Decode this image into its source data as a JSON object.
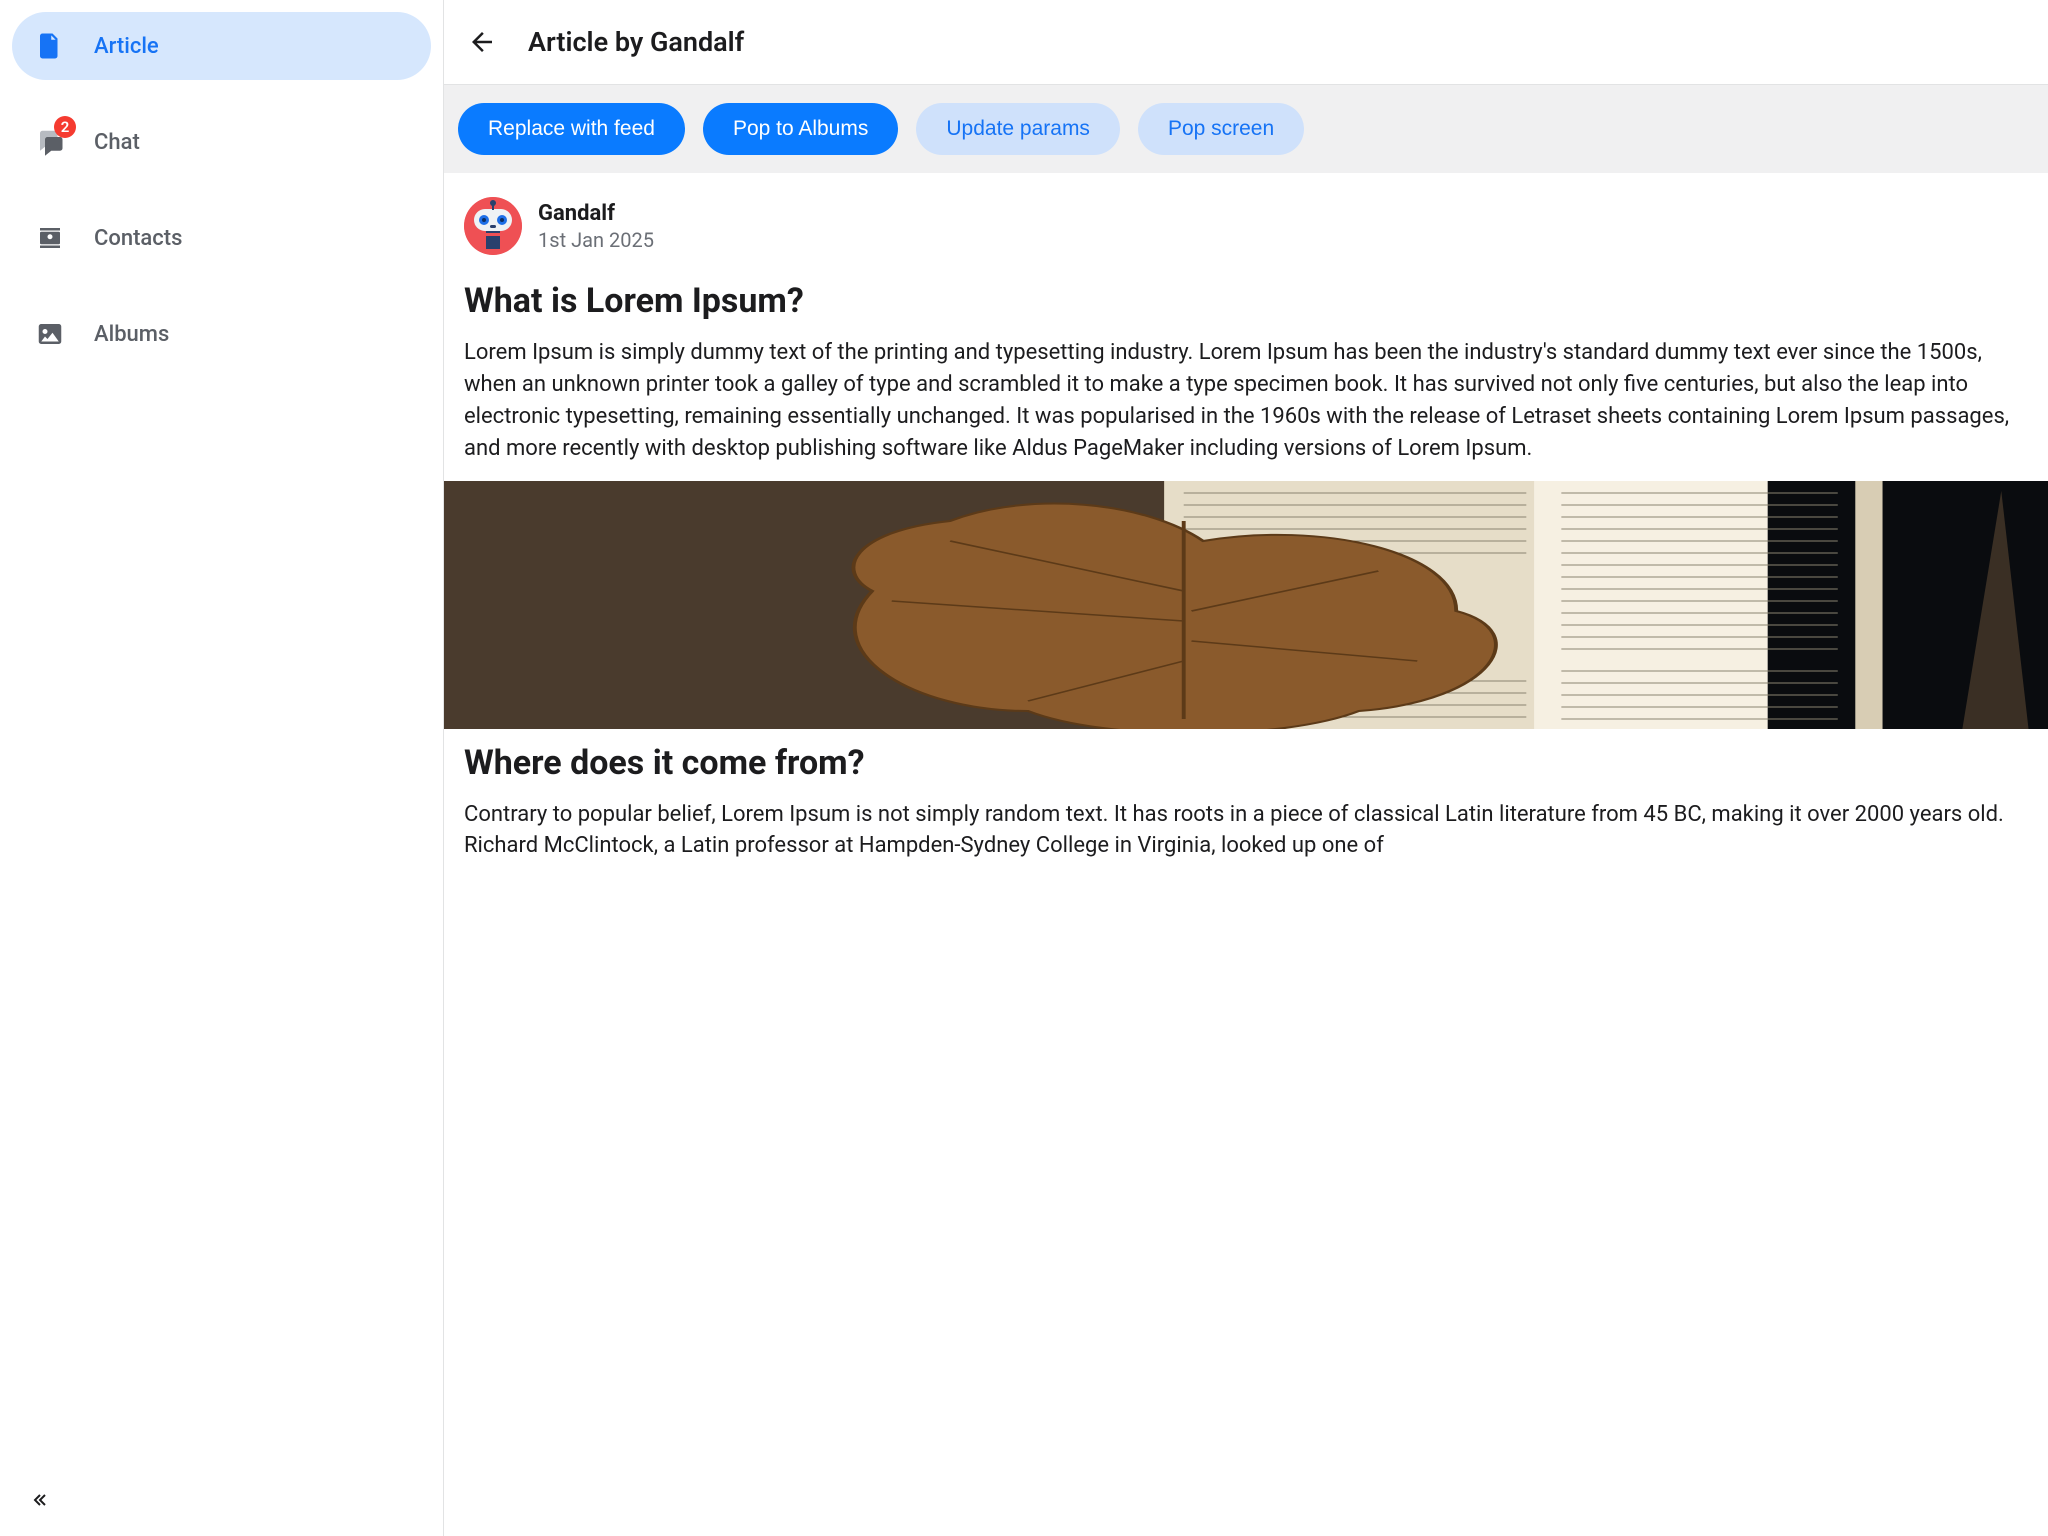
{
  "sidebar": {
    "items": [
      {
        "label": "Article",
        "icon": "document-icon",
        "active": true
      },
      {
        "label": "Chat",
        "icon": "chat-icon",
        "badge": "2"
      },
      {
        "label": "Contacts",
        "icon": "contact-icon"
      },
      {
        "label": "Albums",
        "icon": "image-icon"
      }
    ]
  },
  "header": {
    "title": "Article by Gandalf"
  },
  "toolbar": {
    "replace_feed": "Replace with feed",
    "pop_albums": "Pop to Albums",
    "update_params": "Update params",
    "pop_screen": "Pop screen"
  },
  "article": {
    "author": "Gandalf",
    "date": "1st Jan 2025",
    "sections": [
      {
        "heading": "What is Lorem Ipsum?",
        "body": "Lorem Ipsum is simply dummy text of the printing and typesetting industry. Lorem Ipsum has been the industry's standard dummy text ever since the 1500s, when an unknown printer took a galley of type and scrambled it to make a type specimen book. It has survived not only five centuries, but also the leap into electronic typesetting, remaining essentially unchanged. It was popularised in the 1960s with the release of Letraset sheets containing Lorem Ipsum passages, and more recently with desktop publishing software like Aldus PageMaker including versions of Lorem Ipsum."
      },
      {
        "heading": "Where does it come from?",
        "body": "Contrary to popular belief, Lorem Ipsum is not simply random text. It has roots in a piece of classical Latin literature from 45 BC, making it over 2000 years old. Richard McClintock, a Latin professor at Hampden-Sydney College in Virginia, looked up one of"
      }
    ]
  }
}
